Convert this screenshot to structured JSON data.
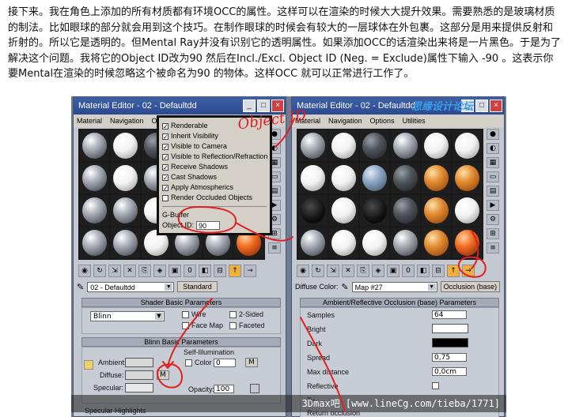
{
  "paragraph": "接下来。我在角色上添加的所有材质都有环境OCC的属性。这样可以在渲染的时候大大提升效果。需要熟悉的是玻璃材质的制法。比如眼球的部分就会用到这个技巧。在制作眼球的时候会有较大的一层球体在外包裹。这部分是用来提供反射和折射的。所以它是透明的。但Mental Ray并没有识别它的透明属性。如果添加OCC的话渲染出来将是一片黑色。于是为了解决这个问题。我将它的Object ID改为90 然后在Incl./Excl. Object ID (Neg. = Exclude)属性下输入 -90 。这表示你要Mental在渲染的时候忽略这个被命名为90 的物体。这样OCC 就可以正常进行工作了。",
  "left_window": {
    "title": "Material Editor - 02 - Defaultdd",
    "menu": [
      "Material",
      "Navigation",
      "Options"
    ],
    "material_name": "02 - Defaultdd",
    "type_button": "Standard",
    "shader_params_header": "Shader Basic Parameters",
    "shader_type": "Blinn",
    "wire": "Wire",
    "two_sided": "2-Sided",
    "face_map": "Face Map",
    "faceted": "Faceted",
    "blinn_header": "Blinn Basic Parameters",
    "self_illum": "Self-Illumination",
    "ambient": "Ambient:",
    "diffuse": "Diffuse:",
    "specular": "Specular:",
    "color": "Color",
    "color_value": "0",
    "opacity": "Opacity:",
    "opacity_value": "100",
    "m": "M",
    "specular_highlights": "Specular Highlights"
  },
  "popup": {
    "items": [
      "Renderable",
      "Inherit Visibility",
      "Visible to Camera",
      "Visible to Reflection/Refraction",
      "Receive Shadows",
      "Cast Shadows",
      "Apply Atmospherics",
      "Render Occluded Objects"
    ],
    "checked": [
      true,
      true,
      true,
      true,
      true,
      true,
      true,
      false
    ],
    "gbuffer": "G-Buffer",
    "object_id_label": "Object ID:",
    "object_id_value": "90"
  },
  "right_window": {
    "title": "Material Editor - 02 - Defaultdd",
    "menu": [
      "Material",
      "Navigation",
      "Options",
      "Utilities"
    ],
    "diffuse_color": "Diffuse Color:",
    "map_name": "Map #27",
    "map_type": "Occlusion (base)",
    "params_header": "Ambient/Reflective Occlusion (base) Parameters",
    "samples": "Samples",
    "samples_value": "64",
    "bright": "Bright",
    "dark": "Dark",
    "spread": "Spread",
    "spread_value": "0,75",
    "max_distance": "Max distance",
    "max_distance_value": "0,0cm",
    "reflective": "Reflective",
    "type_label": "Ty",
    "return_occ": "Return occlusion",
    "incl_excl": "Incl./Excl. Object ID (Neg. = Exclude)"
  },
  "watermark_logo": "思缘设计论坛",
  "footer": "3Dmax吧 [www.lineCg.com/tieba/1771]",
  "handwriting": "Object ID",
  "colors": {
    "annotation": "#e02020",
    "titlebar": "#2a4a92"
  }
}
